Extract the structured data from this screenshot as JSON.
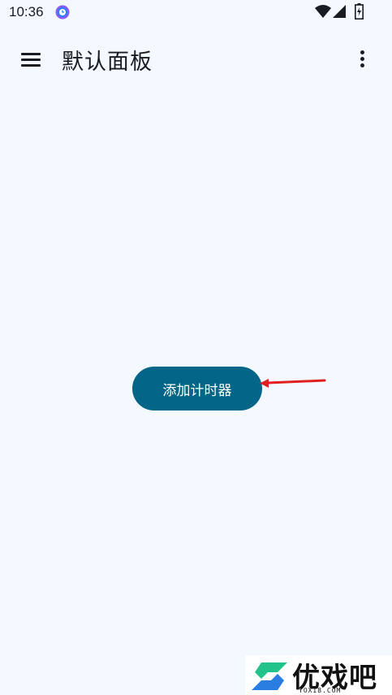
{
  "status_bar": {
    "time": "10:36",
    "icons": [
      "clock-app-icon",
      "wifi-icon",
      "signal-icon",
      "battery-icon"
    ]
  },
  "app_bar": {
    "title": "默认面板",
    "menu_icon": "hamburger-menu-icon",
    "more_icon": "more-vert-icon"
  },
  "main": {
    "add_timer_label": "添加计时器"
  },
  "watermark": {
    "text": "优戏吧",
    "domain": "YOXI8.COM"
  },
  "colors": {
    "background": "#f3f9ff",
    "primary_button": "#036689",
    "annotation_arrow": "#e02020"
  }
}
